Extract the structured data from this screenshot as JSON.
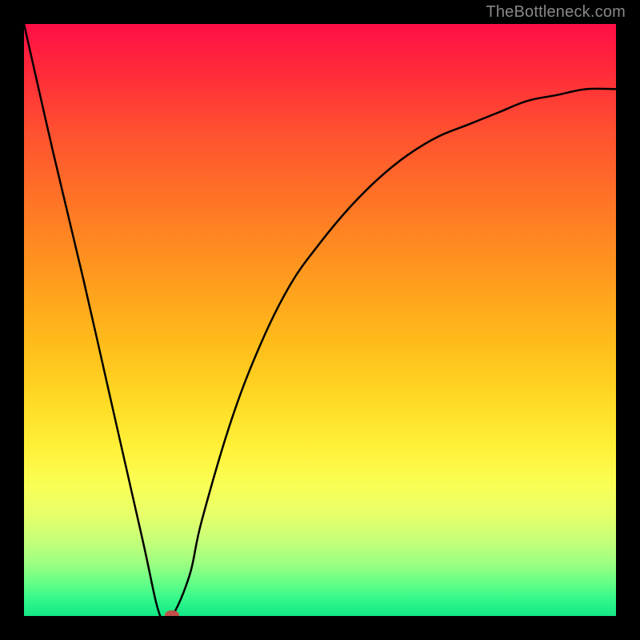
{
  "attribution": "TheBottleneck.com",
  "chart_data": {
    "type": "line",
    "title": "",
    "xlabel": "",
    "ylabel": "",
    "ylim": [
      0,
      100
    ],
    "x": [
      0,
      5,
      10,
      15,
      20,
      23,
      25,
      28,
      30,
      35,
      40,
      45,
      50,
      55,
      60,
      65,
      70,
      75,
      80,
      85,
      90,
      95,
      100
    ],
    "values": [
      100,
      78,
      57,
      35,
      13,
      0,
      0,
      7,
      16,
      33,
      46,
      56,
      63,
      69,
      74,
      78,
      81,
      83,
      85,
      87,
      88,
      89,
      89
    ],
    "marker": {
      "x": 25,
      "y": 0
    },
    "colors": {
      "top": "#ff0e45",
      "mid": "#ffd725",
      "bottom": "#12e786",
      "marker": "#c05048",
      "line": "#000000"
    }
  }
}
